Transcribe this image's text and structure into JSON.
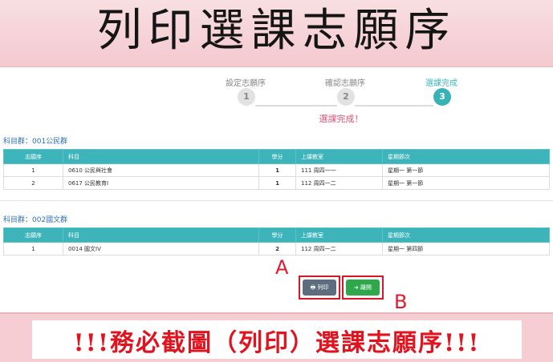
{
  "banner": {
    "title": "列印選課志願序"
  },
  "steps": [
    {
      "label": "設定志願序",
      "number": "1"
    },
    {
      "label": "確認志願序",
      "number": "2"
    },
    {
      "label": "選課完成",
      "number": "3"
    }
  ],
  "done_message": "選課完成！",
  "headers": {
    "rank": "志願序",
    "course": "科目",
    "credits": "學分",
    "room": "上課教室",
    "time": "星期節次"
  },
  "groups": [
    {
      "title": "科目群：001公民群",
      "rows": [
        {
          "rank": "1",
          "course": "0610 公民與社會",
          "credits": "1",
          "room": "111 周四一一",
          "time": "星期一 第一節"
        },
        {
          "rank": "2",
          "course": "0617 公民教育Ⅰ",
          "credits": "1",
          "room": "112 周四一二",
          "time": "星期一 第一節"
        }
      ]
    },
    {
      "title": "科目群：002國文群",
      "rows": [
        {
          "rank": "1",
          "course": "0014 國文IV",
          "credits": "2",
          "room": "112 周四一二",
          "time": "星期一 第四節"
        }
      ]
    }
  ],
  "buttons": {
    "print": "🖶 列印",
    "leave": "➜ 離開"
  },
  "markers": {
    "a": "A",
    "b": "B"
  },
  "footer": {
    "text": "!!!務必截圖（列印）選課志願序!!!"
  },
  "colors": {
    "teal": "#3db4ba",
    "print_btn": "#5d6d7e",
    "leave_btn": "#2ea84a",
    "highlight": "#d8162a"
  }
}
